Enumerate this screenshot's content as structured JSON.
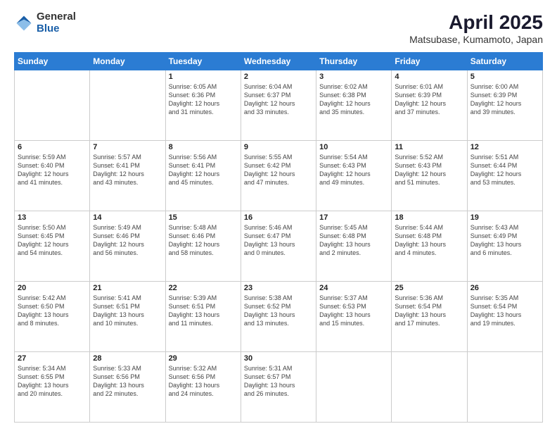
{
  "logo": {
    "general": "General",
    "blue": "Blue"
  },
  "title": {
    "month": "April 2025",
    "location": "Matsubase, Kumamoto, Japan"
  },
  "weekdays": [
    "Sunday",
    "Monday",
    "Tuesday",
    "Wednesday",
    "Thursday",
    "Friday",
    "Saturday"
  ],
  "weeks": [
    [
      {
        "day": "",
        "info": ""
      },
      {
        "day": "",
        "info": ""
      },
      {
        "day": "1",
        "info": "Sunrise: 6:05 AM\nSunset: 6:36 PM\nDaylight: 12 hours\nand 31 minutes."
      },
      {
        "day": "2",
        "info": "Sunrise: 6:04 AM\nSunset: 6:37 PM\nDaylight: 12 hours\nand 33 minutes."
      },
      {
        "day": "3",
        "info": "Sunrise: 6:02 AM\nSunset: 6:38 PM\nDaylight: 12 hours\nand 35 minutes."
      },
      {
        "day": "4",
        "info": "Sunrise: 6:01 AM\nSunset: 6:39 PM\nDaylight: 12 hours\nand 37 minutes."
      },
      {
        "day": "5",
        "info": "Sunrise: 6:00 AM\nSunset: 6:39 PM\nDaylight: 12 hours\nand 39 minutes."
      }
    ],
    [
      {
        "day": "6",
        "info": "Sunrise: 5:59 AM\nSunset: 6:40 PM\nDaylight: 12 hours\nand 41 minutes."
      },
      {
        "day": "7",
        "info": "Sunrise: 5:57 AM\nSunset: 6:41 PM\nDaylight: 12 hours\nand 43 minutes."
      },
      {
        "day": "8",
        "info": "Sunrise: 5:56 AM\nSunset: 6:41 PM\nDaylight: 12 hours\nand 45 minutes."
      },
      {
        "day": "9",
        "info": "Sunrise: 5:55 AM\nSunset: 6:42 PM\nDaylight: 12 hours\nand 47 minutes."
      },
      {
        "day": "10",
        "info": "Sunrise: 5:54 AM\nSunset: 6:43 PM\nDaylight: 12 hours\nand 49 minutes."
      },
      {
        "day": "11",
        "info": "Sunrise: 5:52 AM\nSunset: 6:43 PM\nDaylight: 12 hours\nand 51 minutes."
      },
      {
        "day": "12",
        "info": "Sunrise: 5:51 AM\nSunset: 6:44 PM\nDaylight: 12 hours\nand 53 minutes."
      }
    ],
    [
      {
        "day": "13",
        "info": "Sunrise: 5:50 AM\nSunset: 6:45 PM\nDaylight: 12 hours\nand 54 minutes."
      },
      {
        "day": "14",
        "info": "Sunrise: 5:49 AM\nSunset: 6:46 PM\nDaylight: 12 hours\nand 56 minutes."
      },
      {
        "day": "15",
        "info": "Sunrise: 5:48 AM\nSunset: 6:46 PM\nDaylight: 12 hours\nand 58 minutes."
      },
      {
        "day": "16",
        "info": "Sunrise: 5:46 AM\nSunset: 6:47 PM\nDaylight: 13 hours\nand 0 minutes."
      },
      {
        "day": "17",
        "info": "Sunrise: 5:45 AM\nSunset: 6:48 PM\nDaylight: 13 hours\nand 2 minutes."
      },
      {
        "day": "18",
        "info": "Sunrise: 5:44 AM\nSunset: 6:48 PM\nDaylight: 13 hours\nand 4 minutes."
      },
      {
        "day": "19",
        "info": "Sunrise: 5:43 AM\nSunset: 6:49 PM\nDaylight: 13 hours\nand 6 minutes."
      }
    ],
    [
      {
        "day": "20",
        "info": "Sunrise: 5:42 AM\nSunset: 6:50 PM\nDaylight: 13 hours\nand 8 minutes."
      },
      {
        "day": "21",
        "info": "Sunrise: 5:41 AM\nSunset: 6:51 PM\nDaylight: 13 hours\nand 10 minutes."
      },
      {
        "day": "22",
        "info": "Sunrise: 5:39 AM\nSunset: 6:51 PM\nDaylight: 13 hours\nand 11 minutes."
      },
      {
        "day": "23",
        "info": "Sunrise: 5:38 AM\nSunset: 6:52 PM\nDaylight: 13 hours\nand 13 minutes."
      },
      {
        "day": "24",
        "info": "Sunrise: 5:37 AM\nSunset: 6:53 PM\nDaylight: 13 hours\nand 15 minutes."
      },
      {
        "day": "25",
        "info": "Sunrise: 5:36 AM\nSunset: 6:54 PM\nDaylight: 13 hours\nand 17 minutes."
      },
      {
        "day": "26",
        "info": "Sunrise: 5:35 AM\nSunset: 6:54 PM\nDaylight: 13 hours\nand 19 minutes."
      }
    ],
    [
      {
        "day": "27",
        "info": "Sunrise: 5:34 AM\nSunset: 6:55 PM\nDaylight: 13 hours\nand 20 minutes."
      },
      {
        "day": "28",
        "info": "Sunrise: 5:33 AM\nSunset: 6:56 PM\nDaylight: 13 hours\nand 22 minutes."
      },
      {
        "day": "29",
        "info": "Sunrise: 5:32 AM\nSunset: 6:56 PM\nDaylight: 13 hours\nand 24 minutes."
      },
      {
        "day": "30",
        "info": "Sunrise: 5:31 AM\nSunset: 6:57 PM\nDaylight: 13 hours\nand 26 minutes."
      },
      {
        "day": "",
        "info": ""
      },
      {
        "day": "",
        "info": ""
      },
      {
        "day": "",
        "info": ""
      }
    ]
  ]
}
